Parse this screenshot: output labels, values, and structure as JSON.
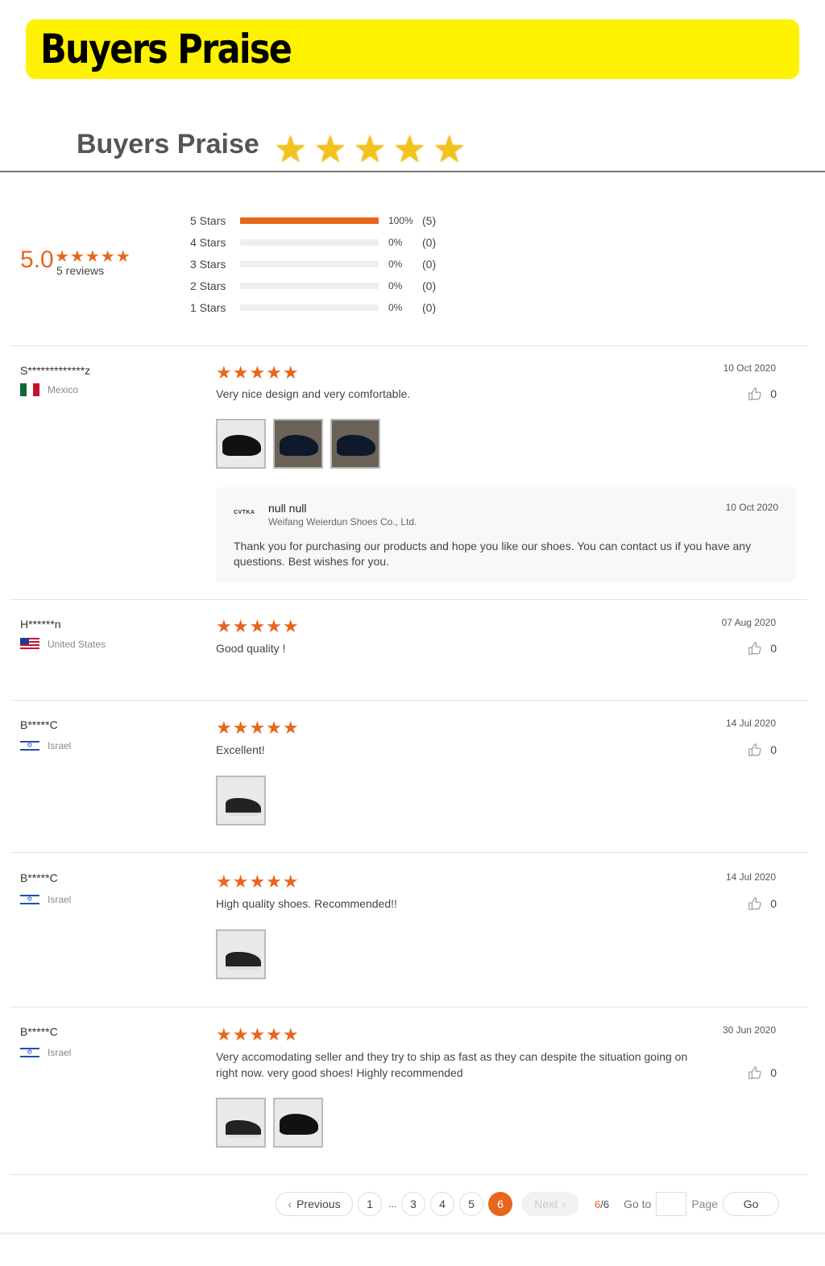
{
  "banner": {
    "title": "Buyers Praise"
  },
  "praise_header": {
    "title": "Buyers Praise",
    "stars": [
      "★",
      "★",
      "★",
      "★",
      "★"
    ]
  },
  "summary": {
    "average": "5.0",
    "stars": "★★★★★",
    "count_label": "5 reviews",
    "distribution": [
      {
        "label": "5 Stars",
        "fraction": 1.0,
        "percent": "100%",
        "count": "(5)"
      },
      {
        "label": "4 Stars",
        "fraction": 0.0,
        "percent": "0%",
        "count": "(0)"
      },
      {
        "label": "3 Stars",
        "fraction": 0.0,
        "percent": "0%",
        "count": "(0)"
      },
      {
        "label": "2 Stars",
        "fraction": 0.0,
        "percent": "0%",
        "count": "(0)"
      },
      {
        "label": "1 Stars",
        "fraction": 0.0,
        "percent": "0%",
        "count": "(0)"
      }
    ]
  },
  "reviews": [
    {
      "name": "S*************z",
      "country": "Mexico",
      "flag": "mexico-flag",
      "stars": "★★★★★",
      "text": "Very nice design and very comfortable.",
      "date": "10 Oct 2020",
      "likes": "0",
      "photos": 3,
      "reply": {
        "logo": "CVTKA",
        "name": "null null",
        "company": "Weifang Weierdun Shoes Co., Ltd.",
        "date": "10 Oct 2020",
        "text": "Thank you for purchasing our products and hope you like our shoes. You can contact us if you have any questions. Best wishes for you."
      }
    },
    {
      "name": "H******n",
      "country": "United States",
      "flag": "us-flag",
      "stars": "★★★★★",
      "text": "Good quality !",
      "date": "07 Aug 2020",
      "likes": "0",
      "photos": 0
    },
    {
      "name": "B*****C",
      "country": "Israel",
      "flag": "israel-flag",
      "stars": "★★★★★",
      "text": "Excellent!",
      "date": "14 Jul 2020",
      "likes": "0",
      "photos": 1
    },
    {
      "name": "B*****C",
      "country": "Israel",
      "flag": "israel-flag",
      "stars": "★★★★★",
      "text": "High quality shoes. Recommended!!",
      "date": "14 Jul 2020",
      "likes": "0",
      "photos": 1
    },
    {
      "name": "B*****C",
      "country": "Israel",
      "flag": "israel-flag",
      "stars": "★★★★★",
      "text": "Very accomodating seller and they try to ship as fast as they can despite the situation going on right now. very good shoes! Highly recommended",
      "date": "30 Jun 2020",
      "likes": "0",
      "photos": 2
    }
  ],
  "pagination": {
    "previous": "Previous",
    "pages": [
      "1",
      "3",
      "4",
      "5",
      "6"
    ],
    "ellipsis": "...",
    "current": "6",
    "next": "Next",
    "total_current": "6",
    "total_sep": "/6",
    "goto_label": "Go to",
    "page_label": "Page",
    "go": "Go"
  },
  "colors": {
    "accent": "#e7661c",
    "banner": "#fff200",
    "gold_star": "#f3c21b"
  }
}
